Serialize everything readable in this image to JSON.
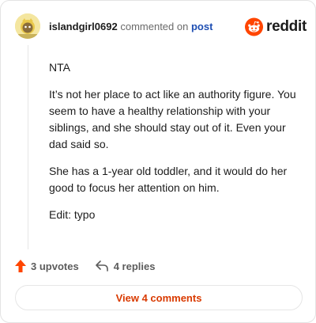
{
  "header": {
    "username": "islandgirl0692",
    "commented_text": "commented on",
    "post_link": "post",
    "brand": "reddit",
    "brand_color": "#ff4500"
  },
  "comment": {
    "paragraphs": [
      "NTA",
      "It’s not her place to act like an authority figure. You seem to have a healthy relationship with your siblings, and she should stay out of it. Even your dad said so.",
      "She has a 1-year old toddler, and it would do her good to focus her attention on him.",
      "Edit: typo"
    ]
  },
  "actions": {
    "upvotes": "3 upvotes",
    "replies": "4 replies",
    "upvote_icon": "upvote-arrow-icon",
    "reply_icon": "reply-arrow-icon"
  },
  "footer": {
    "view_comments": "View 4 comments",
    "accent": "#d93a00"
  }
}
